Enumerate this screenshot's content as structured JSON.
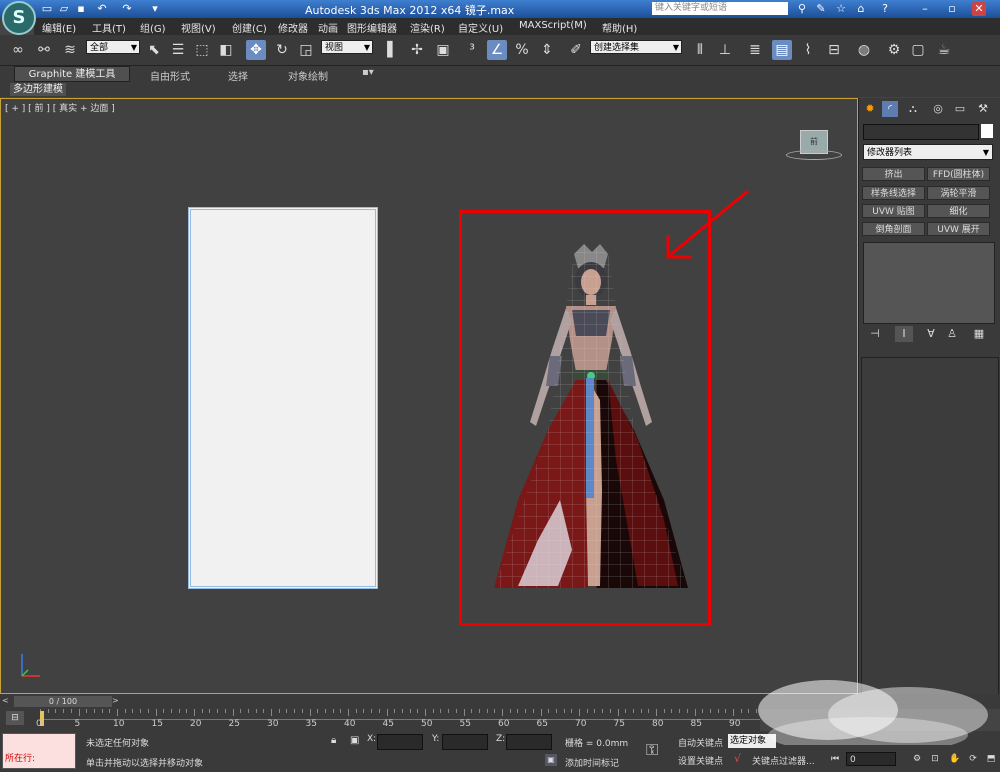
{
  "title_bar": {
    "title": "Autodesk 3ds Max  2012 x64      镜子.max",
    "search_placeholder": "键入关键字或短语"
  },
  "menu": [
    "编辑(E)",
    "工具(T)",
    "组(G)",
    "视图(V)",
    "创建(C)",
    "修改器",
    "动画",
    "图形编辑器",
    "渲染(R)",
    "自定义(U)",
    "MAXScript(M)",
    "帮助(H)"
  ],
  "toolbar": {
    "selection_filter": "全部",
    "ref_coord": "视图",
    "named_selection": "创建选择集"
  },
  "ribbon": {
    "tabs": [
      "Graphite 建模工具",
      "自由形式",
      "选择",
      "对象绘制"
    ],
    "panel": "多边形建模"
  },
  "viewport": {
    "label": "[ + ] [ 前 ] [ 真实 + 边面 ]",
    "viewcube_label": "前"
  },
  "command_panel": {
    "modifier_list": "修改器列表",
    "buttons": [
      "挤出",
      "FFD(圆柱体)",
      "样条线选择",
      "涡轮平滑",
      "UVW 贴图",
      "细化",
      "倒角剖面",
      "UVW 展开"
    ]
  },
  "time_slider": {
    "position": "0 / 100",
    "ticks": [
      "0",
      "5",
      "10",
      "15",
      "20",
      "25",
      "30",
      "35",
      "40",
      "45",
      "50",
      "55",
      "60",
      "65",
      "70",
      "75",
      "80",
      "85",
      "90"
    ]
  },
  "status": {
    "listener": "所在行:",
    "message1": "未选定任何对象",
    "message2": "单击并拖动以选择并移动对象",
    "x_label": "X:",
    "y_label": "Y:",
    "z_label": "Z:",
    "grid": "栅格 = 0.0mm",
    "add_time_tag": "添加时间标记",
    "auto_key": "自动关键点",
    "set_key": "设置关键点",
    "selected_object": "选定对象",
    "key_filters": "关键点过滤器...",
    "frame": "0"
  },
  "colors": {
    "title_bar": "#1d4f98",
    "viewport_bg": "#414141",
    "active_border": "#c9a235",
    "highlight_box": "#e00000",
    "mirror_plane": "#f1f1f1"
  }
}
